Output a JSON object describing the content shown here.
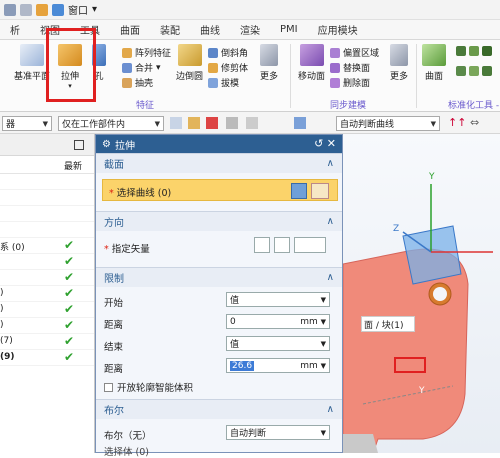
{
  "quick_access": {
    "window_label": "窗口"
  },
  "menu": [
    "析",
    "视图",
    "工具",
    "曲面",
    "装配",
    "曲线",
    "渲染",
    "PMI",
    "应用模块"
  ],
  "ribbon": {
    "datum_plane": "基准平面",
    "extrude": "拉伸",
    "hole": "孔",
    "array_feature": "阵列特征",
    "unite": "合并",
    "shell": "抽壳",
    "edge_blend": "边倒圆",
    "chamfer": "倒斜角",
    "trim_body": "修剪体",
    "draft": "拔模",
    "more1": "更多",
    "move_face": "移动面",
    "offset_region": "偏置区域",
    "replace_face": "替换面",
    "delete_face": "删除面",
    "more2": "更多",
    "surface": "曲面",
    "group_feature": "特征",
    "group_sync": "同步建模",
    "group_std": "标准化工具 -"
  },
  "selection_bar": {
    "filter_left": "器",
    "scope": "仅在工作部件内",
    "curve_rule": "自动判断曲线"
  },
  "navigator": {
    "col_latest": "最新",
    "rows": [
      {
        "text": "",
        "check": false
      },
      {
        "text": "",
        "check": false
      },
      {
        "text": "",
        "check": false
      },
      {
        "text": "",
        "check": false
      },
      {
        "text": "系 (0)",
        "check": true
      },
      {
        "text": "",
        "check": true
      },
      {
        "text": "",
        "check": true
      },
      {
        "text": ")",
        "check": true
      },
      {
        "text": ")",
        "check": true
      },
      {
        "text": ")",
        "check": true
      },
      {
        "text": "(7)",
        "check": true
      },
      {
        "text": "(9)",
        "check": true
      }
    ]
  },
  "dialog": {
    "title": "拉伸",
    "section": "截面",
    "select_curve": "选择曲线 (0)",
    "direction": "方向",
    "specify_vector": "指定矢量",
    "limits": "限制",
    "start_label": "开始",
    "start_value": "值",
    "distance1_label": "距离",
    "distance1_value": "0",
    "unit1": "mm",
    "end_label": "结束",
    "end_value": "值",
    "distance2_label": "距离",
    "distance2_value": "26.6",
    "unit2": "mm",
    "open_profile": "开放轮廓智能体积",
    "boolean": "布尔",
    "boolean_label": "布尔（无）",
    "boolean_value": "自动判断",
    "select_body": "选择体 (0)"
  },
  "viewport": {
    "face_label": "面 / 块(1)",
    "axis_y": "Y",
    "axis_z": "Z",
    "axis_x": "X",
    "axis_y2": "Y"
  }
}
